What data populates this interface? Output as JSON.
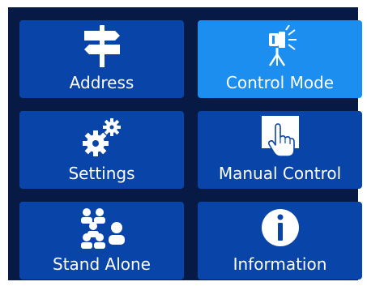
{
  "menu": {
    "tiles": [
      {
        "label": "Address",
        "icon": "signpost-icon"
      },
      {
        "label": "Control Mode",
        "icon": "spotlight-icon",
        "selected": true
      },
      {
        "label": "Settings",
        "icon": "gears-icon"
      },
      {
        "label": "Manual Control",
        "icon": "touch-hand-icon"
      },
      {
        "label": "Stand Alone",
        "icon": "people-group-icon"
      },
      {
        "label": "Information",
        "icon": "info-icon"
      }
    ]
  },
  "colors": {
    "background": "#061a45",
    "tile": "#0944a8",
    "tile_selected": "#1c8ef0",
    "text": "#ffffff"
  }
}
